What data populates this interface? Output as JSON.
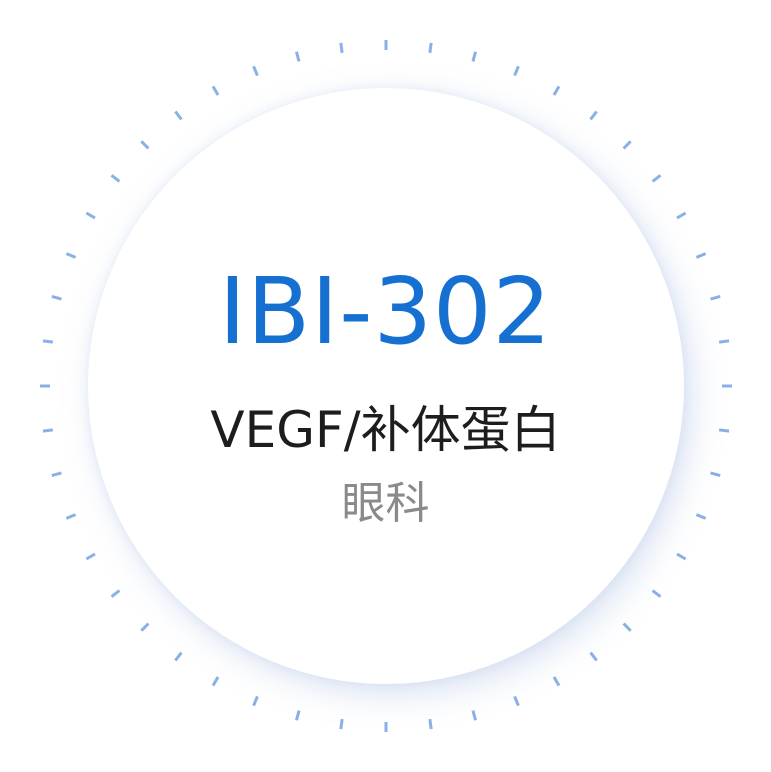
{
  "card": {
    "code": "IBI-302",
    "target": "VEGF/补体蛋白",
    "area": "眼科"
  },
  "colors": {
    "accent": "#1670d2",
    "tick": "#8ab1e6",
    "target_text": "#1d1d1d",
    "area_text": "#8a8a8a"
  },
  "ring": {
    "tick_count": 48,
    "icon": "dashed-ring-decoration"
  }
}
